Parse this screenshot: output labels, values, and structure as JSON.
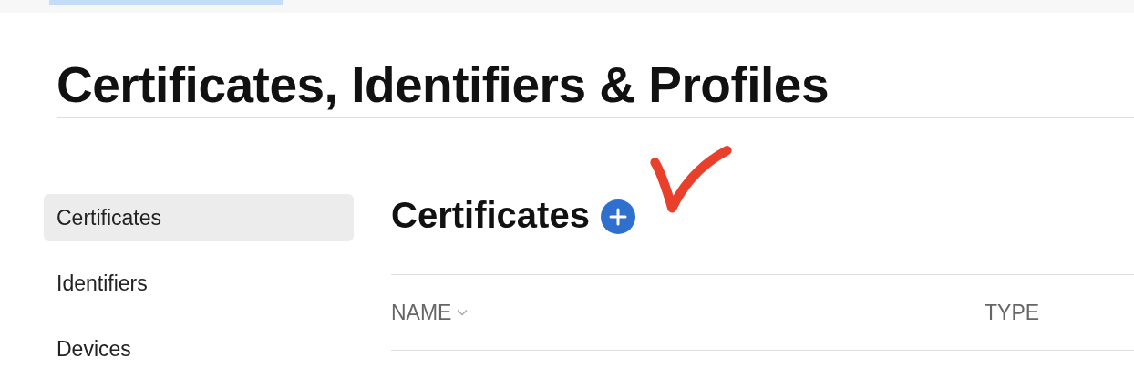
{
  "page": {
    "title": "Certificates, Identifiers & Profiles"
  },
  "sidebar": {
    "items": [
      {
        "label": "Certificates",
        "selected": true
      },
      {
        "label": "Identifiers",
        "selected": false
      },
      {
        "label": "Devices",
        "selected": false
      }
    ]
  },
  "section": {
    "title": "Certificates"
  },
  "table": {
    "columns": [
      {
        "label": "NAME",
        "sorted": true
      },
      {
        "label": "TYPE",
        "sorted": false
      }
    ]
  }
}
